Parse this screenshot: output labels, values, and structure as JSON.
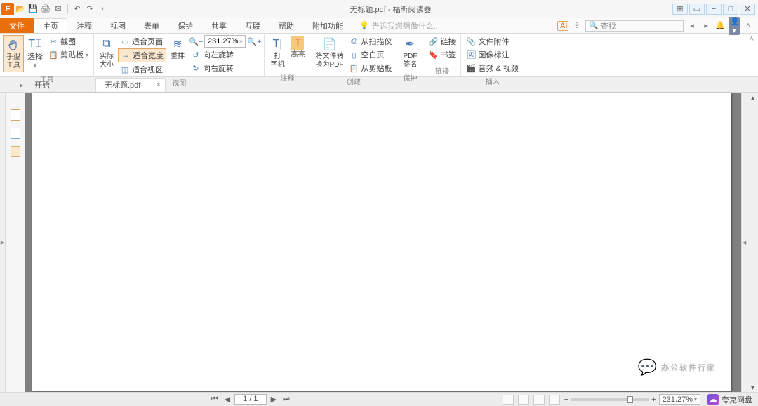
{
  "app": {
    "title": "无标题.pdf - 福昕阅读器"
  },
  "qat": {
    "logo": "F"
  },
  "win": {
    "group": "⊞",
    "ribbon": "▭",
    "min": "−",
    "max": "□",
    "close": "✕"
  },
  "menu": {
    "file": "文件",
    "tabs": [
      "主页",
      "注释",
      "视图",
      "表单",
      "保护",
      "共享",
      "互联",
      "帮助",
      "附加功能"
    ],
    "active_index": 0,
    "tellme": "告诉我您想做什么...",
    "search": "查找",
    "ai": "AI"
  },
  "ribbon": {
    "tools": {
      "label": "工具",
      "hand": "手型\n工具",
      "select": "选择",
      "snapshot": "截图",
      "clipboard": "剪贴板"
    },
    "view": {
      "label": "视图",
      "actual": "实际\n大小",
      "fitpage": "适合页面",
      "fitwidth": "适合宽度",
      "fitvisible": "适合视区",
      "reflow": "重排",
      "zoom": "231.27%",
      "rotleft": "向左旋转",
      "rotright": "向右旋转"
    },
    "annot": {
      "label": "注释",
      "type": "打\n字机",
      "highlight": "高亮"
    },
    "create": {
      "label": "创建",
      "convert": "将文件转\n换为PDF",
      "scanner": "从扫描仪",
      "blank": "空白页",
      "clipb": "从剪贴板"
    },
    "protect": {
      "label": "保护",
      "sign": "PDF\n签名"
    },
    "links": {
      "label": "链接",
      "link": "链接",
      "bookmark": "书签"
    },
    "insert": {
      "label": "插入",
      "attach": "文件附件",
      "imgannot": "图像标注",
      "av": "音频 & 视频"
    }
  },
  "doctabs": {
    "start": "开始",
    "items": [
      {
        "label": "无标题.pdf",
        "closable": true
      }
    ],
    "active": 0
  },
  "status": {
    "page": "1 / 1",
    "zoom": "231.27%",
    "service": "夸克网盘"
  },
  "watermark": "办公软件行家"
}
